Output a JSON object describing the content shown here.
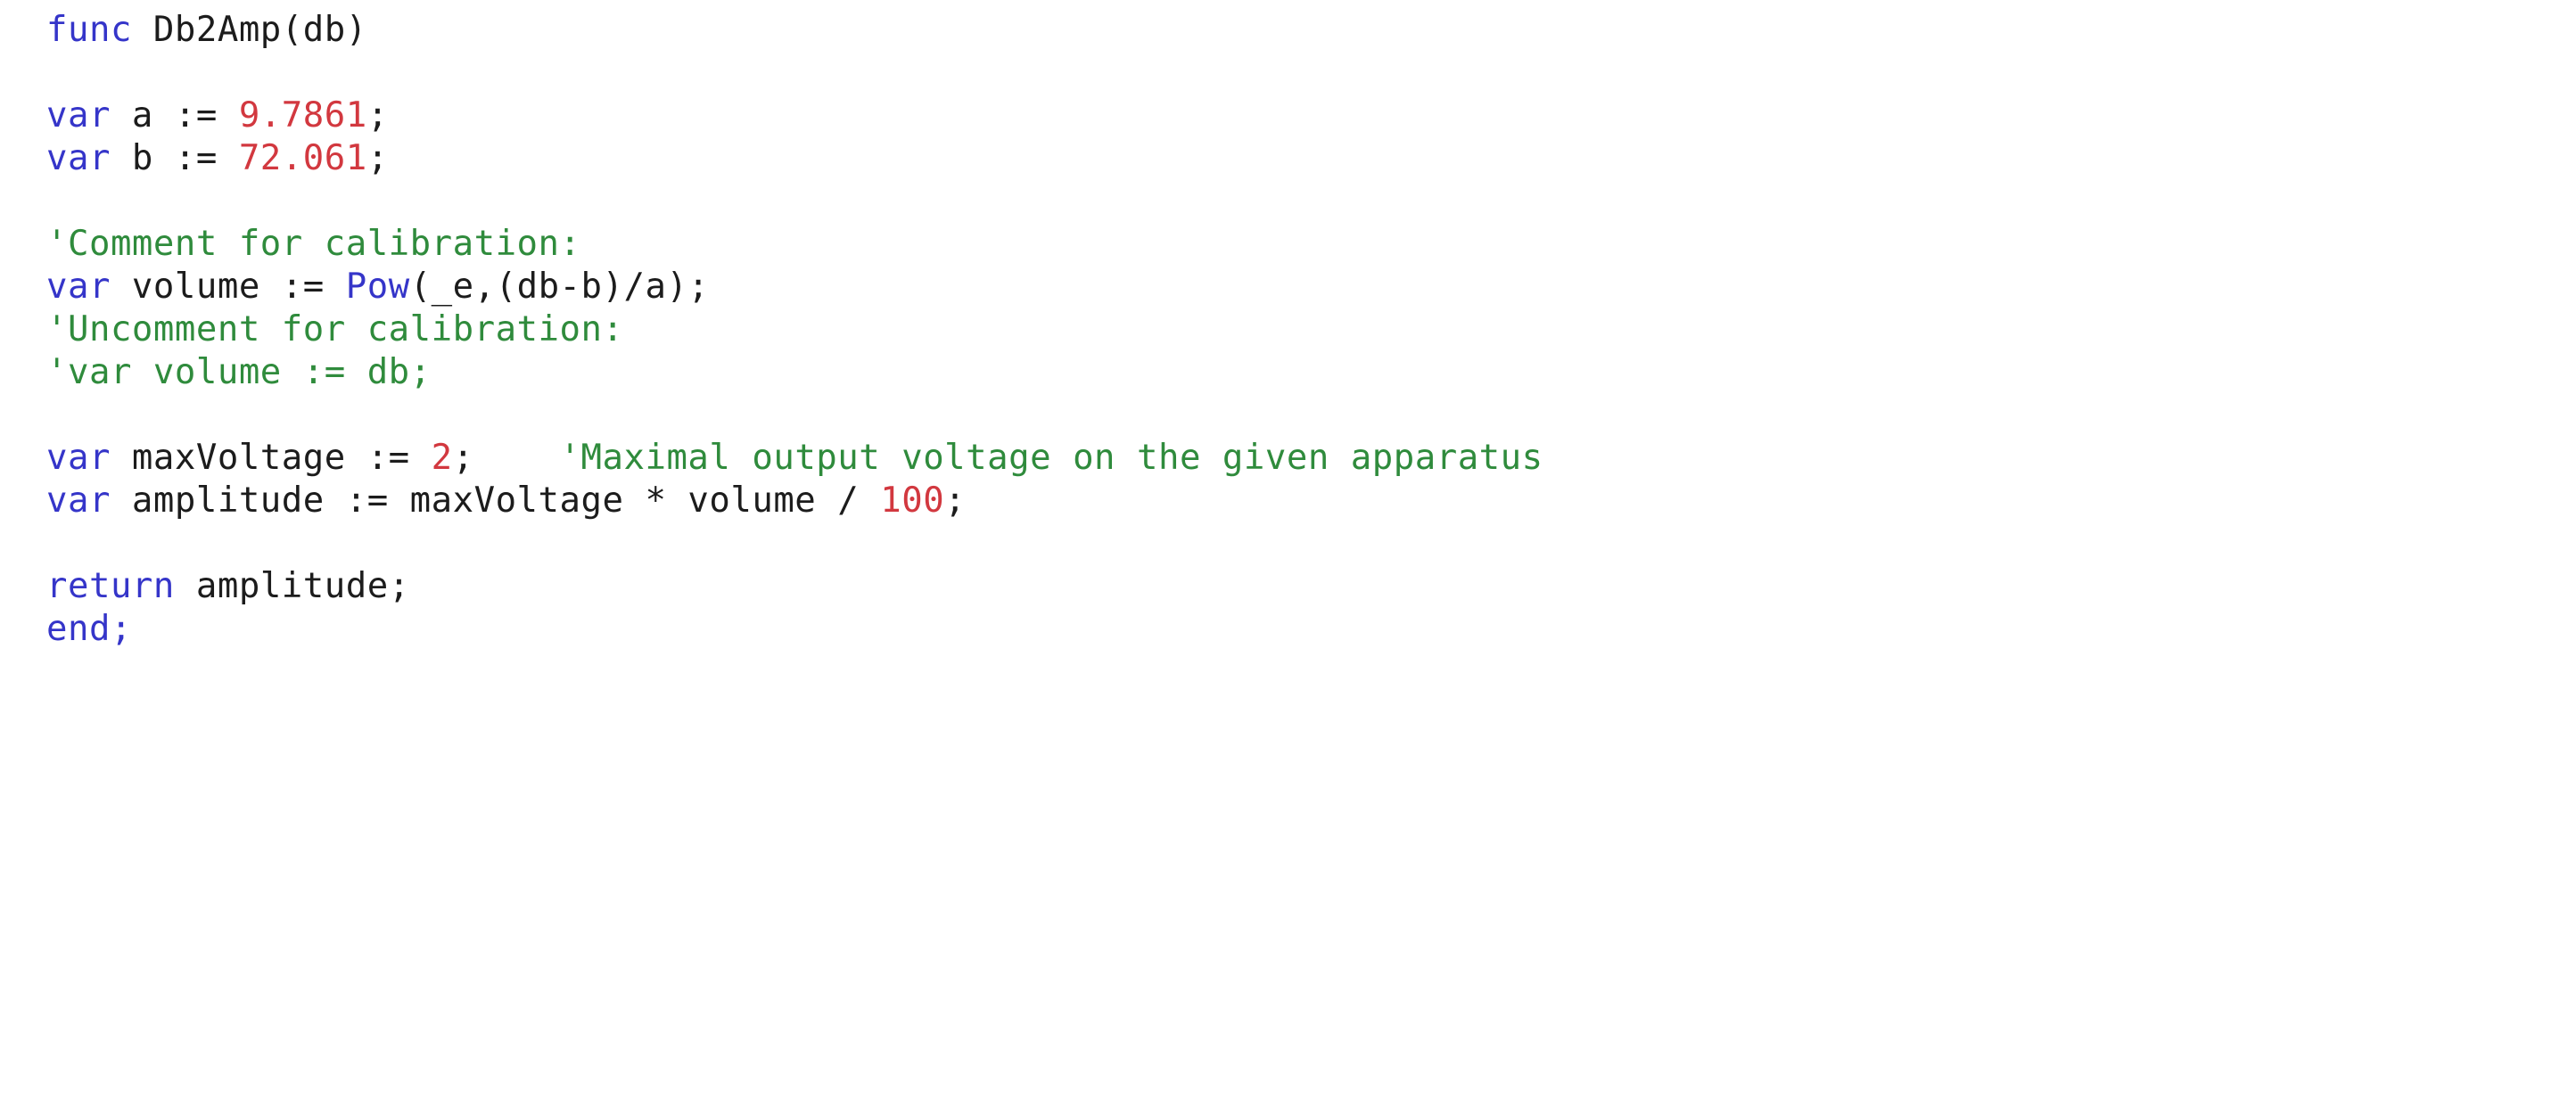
{
  "editor": {
    "language": "script",
    "function_name": "Db2Amp",
    "background_color": "#ffffff",
    "colors": {
      "keyword": "#3535c9",
      "plain": "#1c1c1c",
      "number": "#d2383f",
      "comment": "#2f8b3c"
    }
  },
  "code": {
    "lines": [
      {
        "id": "line-1",
        "type": "code",
        "tokens": [
          {
            "text": "func ",
            "kind": "keyword"
          },
          {
            "text": "Db2Amp(db)",
            "kind": "plain"
          }
        ]
      },
      {
        "id": "line-2",
        "type": "blank",
        "tokens": []
      },
      {
        "id": "line-3",
        "type": "code",
        "tokens": [
          {
            "text": "var ",
            "kind": "keyword"
          },
          {
            "text": "a := ",
            "kind": "plain"
          },
          {
            "text": "9.7861",
            "kind": "number"
          },
          {
            "text": ";",
            "kind": "punct"
          }
        ]
      },
      {
        "id": "line-4",
        "type": "code",
        "tokens": [
          {
            "text": "var ",
            "kind": "keyword"
          },
          {
            "text": "b := ",
            "kind": "plain"
          },
          {
            "text": "72.061",
            "kind": "number"
          },
          {
            "text": ";",
            "kind": "punct"
          }
        ]
      },
      {
        "id": "line-5",
        "type": "blank",
        "tokens": []
      },
      {
        "id": "line-6",
        "type": "comment",
        "tokens": [
          {
            "text": "'Comment for calibration:",
            "kind": "comment"
          }
        ]
      },
      {
        "id": "line-7",
        "type": "code",
        "tokens": [
          {
            "text": "var ",
            "kind": "keyword"
          },
          {
            "text": "volume := ",
            "kind": "plain"
          },
          {
            "text": "Pow",
            "kind": "keyword"
          },
          {
            "text": "(_e,(db-b)/a);",
            "kind": "plain"
          }
        ]
      },
      {
        "id": "line-8",
        "type": "comment",
        "tokens": [
          {
            "text": "'Uncomment for calibration:",
            "kind": "comment"
          }
        ]
      },
      {
        "id": "line-9",
        "type": "comment",
        "tokens": [
          {
            "text": "'var volume := db;",
            "kind": "comment"
          }
        ]
      },
      {
        "id": "line-10",
        "type": "blank",
        "tokens": []
      },
      {
        "id": "line-11",
        "type": "code",
        "tokens": [
          {
            "text": "var ",
            "kind": "keyword"
          },
          {
            "text": "maxVoltage := ",
            "kind": "plain"
          },
          {
            "text": "2",
            "kind": "number"
          },
          {
            "text": ";",
            "kind": "punct"
          },
          {
            "text": "    ",
            "kind": "plain"
          },
          {
            "text": "'Maximal output voltage on the given apparatus",
            "kind": "comment"
          }
        ]
      },
      {
        "id": "line-12",
        "type": "code",
        "tokens": [
          {
            "text": "var ",
            "kind": "keyword"
          },
          {
            "text": "amplitude := maxVoltage * volume / ",
            "kind": "plain"
          },
          {
            "text": "100",
            "kind": "number"
          },
          {
            "text": ";",
            "kind": "punct"
          }
        ]
      },
      {
        "id": "line-13",
        "type": "blank",
        "tokens": []
      },
      {
        "id": "line-14",
        "type": "code",
        "tokens": [
          {
            "text": "return ",
            "kind": "keyword"
          },
          {
            "text": "amplitude;",
            "kind": "plain"
          }
        ]
      },
      {
        "id": "line-15",
        "type": "code",
        "tokens": [
          {
            "text": "end",
            "kind": "keyword"
          },
          {
            "text": ";",
            "kind": "keyword"
          }
        ]
      }
    ]
  }
}
